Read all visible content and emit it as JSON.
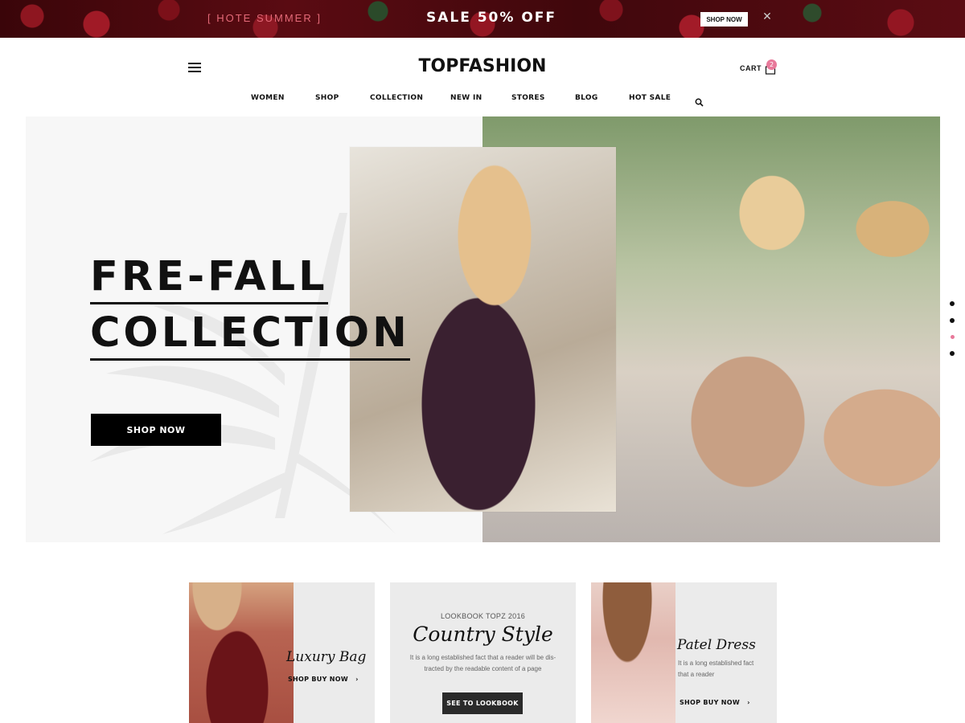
{
  "promo": {
    "left_text": "[ HOTE SUMMER ]",
    "center_text": "SALE 50% OFF",
    "button_label": "SHOP NOW",
    "close_symbol": "✕"
  },
  "header": {
    "logo": "TOPFASHION",
    "cart_label": "CART",
    "cart_count": "2",
    "menu_icon": "hamburger-menu-icon",
    "cart_icon": "shopping-bag-icon"
  },
  "nav": {
    "items": [
      "WOMEN",
      "SHOP",
      "COLLECTION",
      "NEW IN",
      "STORES",
      "BLOG",
      "HOT SALE"
    ],
    "search_icon": "search-icon"
  },
  "hero": {
    "title_line1": "FRE-FALL",
    "title_line2": "COLLECTION",
    "button_label": "SHOP NOW",
    "slide_count": 4,
    "active_slide": 3
  },
  "cards": [
    {
      "title": "Luxury Bag",
      "link": "SHOP BUY NOW",
      "arrow": "›"
    },
    {
      "kicker": "LOOKBOOK TOPZ 2016",
      "title": "Country Style",
      "text_line1": "It is a long established fact that a reader will be dis-",
      "text_line2": "tracted by the readable content of a page",
      "button_label": "SEE TO LOOKBOOK"
    },
    {
      "title": "Patel Dress",
      "text_line1": "It is a long established fact",
      "text_line2": "that a reader",
      "link": "SHOP BUY NOW",
      "arrow": "›"
    }
  ],
  "colors": {
    "accent_pink": "#e8799a",
    "promo_text_pink": "#e46a78",
    "dark": "#111111"
  }
}
